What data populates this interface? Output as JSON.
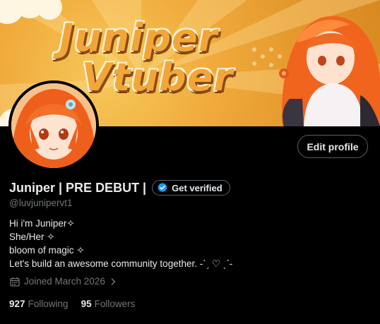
{
  "banner": {
    "title_line1": "Juniper",
    "title_line2": "Vtuber"
  },
  "profile": {
    "display_name": "Juniper | PRE DEBUT |",
    "handle": "@luvjunipervt1",
    "verify_label": "Get verified",
    "edit_label": "Edit profile",
    "bio": [
      "Hi i'm Juniper✧",
      "She/Her  ✧",
      "bloom of magic ✧",
      "Let's build an awesome community together. -ˋˏ ♡ ˎˊ-"
    ],
    "joined": "Joined March 2026",
    "following_count": "927",
    "following_label": "Following",
    "followers_count": "95",
    "followers_label": "Followers"
  },
  "colors": {
    "background": "#000000",
    "text_primary": "#e7e9ea",
    "text_secondary": "#71767b",
    "verify_blue": "#1d9bf0",
    "banner_orange": "#f0a93a"
  },
  "icons": [
    "calendar-icon",
    "verified-check-icon",
    "chevron-right-icon"
  ]
}
